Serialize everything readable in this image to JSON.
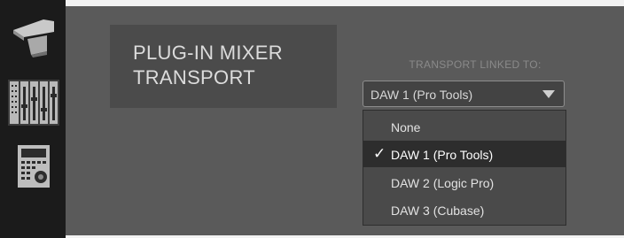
{
  "section": {
    "title": "PLUG-IN MIXER\nTRANSPORT"
  },
  "transport": {
    "label": "TRANSPORT LINKED TO:",
    "selected": "DAW 1 (Pro Tools)",
    "options": [
      {
        "label": "None",
        "selected": false
      },
      {
        "label": "DAW 1 (Pro Tools)",
        "selected": true
      },
      {
        "label": "DAW 2 (Logic Pro)",
        "selected": false
      },
      {
        "label": "DAW 3 (Cubase)",
        "selected": false
      }
    ],
    "check_glyph": "✓"
  },
  "sidebar": {
    "items": [
      {
        "icon": "controller-surface-icon"
      },
      {
        "icon": "fader-mixer-icon"
      },
      {
        "icon": "control-unit-icon"
      }
    ]
  },
  "colors": {
    "rail": "#1b1b1b",
    "panel": "#5a5a5a",
    "section": "#4b4b4b",
    "menu": "#4a4a4a",
    "menu_selected": "#2d2d2d"
  }
}
